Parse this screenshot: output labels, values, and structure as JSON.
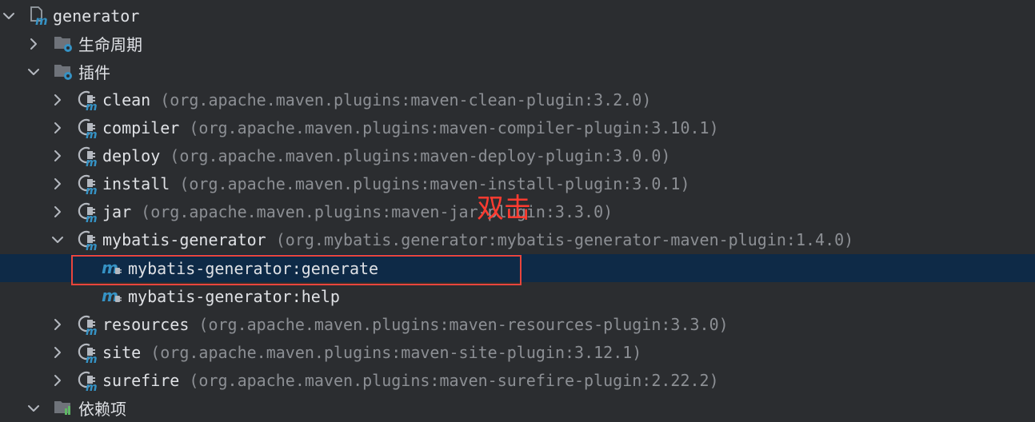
{
  "tree": {
    "root": {
      "label": "generator",
      "icon": "maven-project-icon",
      "expanded": true
    },
    "lifecycle": {
      "label": "生命周期",
      "icon": "folder-gear-icon",
      "expanded": false
    },
    "plugins": {
      "label": "插件",
      "icon": "folder-gear-icon",
      "expanded": true
    },
    "plugin_items": [
      {
        "name": "clean",
        "coord": "(org.apache.maven.plugins:maven-clean-plugin:3.2.0)",
        "expanded": false
      },
      {
        "name": "compiler",
        "coord": "(org.apache.maven.plugins:maven-compiler-plugin:3.10.1)",
        "expanded": false
      },
      {
        "name": "deploy",
        "coord": "(org.apache.maven.plugins:maven-deploy-plugin:3.0.0)",
        "expanded": false
      },
      {
        "name": "install",
        "coord": "(org.apache.maven.plugins:maven-install-plugin:3.0.1)",
        "expanded": false
      },
      {
        "name": "jar",
        "coord": "(org.apache.maven.plugins:maven-jar-plugin:3.3.0)",
        "expanded": false
      },
      {
        "name": "mybatis-generator",
        "coord": "(org.mybatis.generator:mybatis-generator-maven-plugin:1.4.0)",
        "expanded": true
      }
    ],
    "goals": [
      {
        "label": "mybatis-generator:generate",
        "selected": true
      },
      {
        "label": "mybatis-generator:help",
        "selected": false
      }
    ],
    "plugin_items_after": [
      {
        "name": "resources",
        "coord": "(org.apache.maven.plugins:maven-resources-plugin:3.3.0)",
        "expanded": false
      },
      {
        "name": "site",
        "coord": "(org.apache.maven.plugins:maven-site-plugin:3.12.1)",
        "expanded": false
      },
      {
        "name": "surefire",
        "coord": "(org.apache.maven.plugins:maven-surefire-plugin:2.22.2)",
        "expanded": false
      }
    ],
    "dependencies": {
      "label": "依赖项",
      "icon": "folder-dependencies-icon",
      "expanded": true
    }
  },
  "annotation": {
    "text": "双击",
    "color": "#e8453c"
  },
  "colors": {
    "background": "#2b2d30",
    "selection": "#0e2a47",
    "text": "#dfe1e5",
    "secondary_text": "#8c8f94",
    "maven_blue": "#3592c4"
  }
}
